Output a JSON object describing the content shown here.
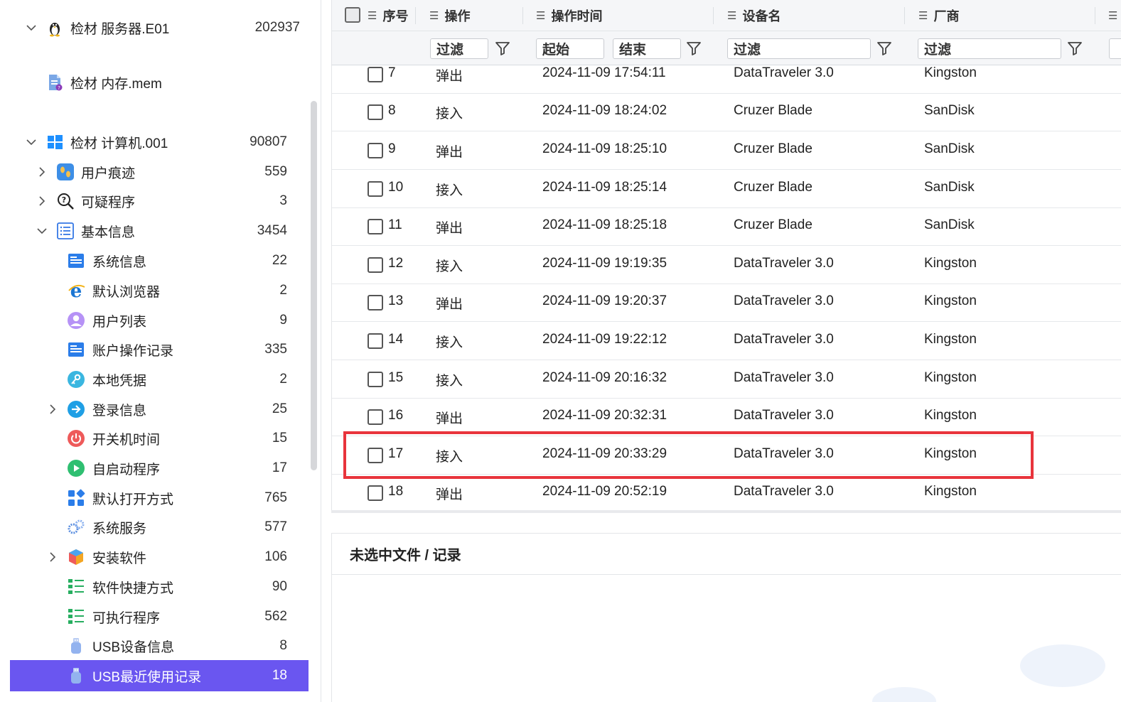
{
  "tree": {
    "items": [
      {
        "label": "检材  服务器.E01",
        "count": "202937",
        "icon": "linux-penguin-icon",
        "expander": "expanded"
      },
      {
        "label": "检材  内存.mem",
        "count": "",
        "icon": "memory-file-icon",
        "expander": ""
      },
      {
        "label": "检材  计算机.001",
        "count": "90807",
        "icon": "windows-logo-icon",
        "expander": "expanded"
      },
      {
        "label": "用户痕迹",
        "count": "559",
        "icon": "footprints-icon",
        "expander": "collapsed"
      },
      {
        "label": "可疑程序",
        "count": "3",
        "icon": "magnifier-question-icon",
        "expander": "collapsed"
      },
      {
        "label": "基本信息",
        "count": "3454",
        "icon": "list-document-icon",
        "expander": "expanded"
      },
      {
        "label": "系统信息",
        "count": "22",
        "icon": "system-info-icon",
        "expander": ""
      },
      {
        "label": "默认浏览器",
        "count": "2",
        "icon": "ie-browser-icon",
        "expander": ""
      },
      {
        "label": "用户列表",
        "count": "9",
        "icon": "user-avatar-icon",
        "expander": ""
      },
      {
        "label": "账户操作记录",
        "count": "335",
        "icon": "account-log-icon",
        "expander": ""
      },
      {
        "label": "本地凭据",
        "count": "2",
        "icon": "key-icon",
        "expander": ""
      },
      {
        "label": "登录信息",
        "count": "25",
        "icon": "login-arrow-icon",
        "expander": "collapsed"
      },
      {
        "label": "开关机时间",
        "count": "15",
        "icon": "power-icon",
        "expander": ""
      },
      {
        "label": "自启动程序",
        "count": "17",
        "icon": "play-icon",
        "expander": ""
      },
      {
        "label": "默认打开方式",
        "count": "765",
        "icon": "apps-grid-icon",
        "expander": ""
      },
      {
        "label": "系统服务",
        "count": "577",
        "icon": "gears-icon",
        "expander": ""
      },
      {
        "label": "安装软件",
        "count": "106",
        "icon": "package-box-icon",
        "expander": "collapsed"
      },
      {
        "label": "软件快捷方式",
        "count": "90",
        "icon": "shortcut-list-icon",
        "expander": ""
      },
      {
        "label": "可执行程序",
        "count": "562",
        "icon": "executable-list-icon",
        "expander": ""
      },
      {
        "label": "USB设备信息",
        "count": "8",
        "icon": "usb-drive-icon",
        "expander": ""
      },
      {
        "label": "USB最近使用记录",
        "count": "18",
        "icon": "usb-drive-icon",
        "expander": "",
        "selected": true
      }
    ]
  },
  "table": {
    "columns": [
      {
        "label": "序号",
        "icon": "column-menu-icon"
      },
      {
        "label": "操作",
        "icon": "column-menu-icon"
      },
      {
        "label": "操作时间",
        "icon": "column-menu-icon"
      },
      {
        "label": "设备名",
        "icon": "column-menu-icon"
      },
      {
        "label": "厂商",
        "icon": "column-menu-icon"
      }
    ],
    "filters": {
      "op": "过滤",
      "time_start": "起始",
      "time_end": "结束",
      "device": "过滤",
      "vendor": "过滤"
    },
    "rows": [
      {
        "no": "7",
        "op": "弹出",
        "time": "2024-11-09 17:54:11",
        "device": "DataTraveler 3.0",
        "vendor": "Kingston"
      },
      {
        "no": "8",
        "op": "接入",
        "time": "2024-11-09 18:24:02",
        "device": "Cruzer Blade",
        "vendor": "SanDisk"
      },
      {
        "no": "9",
        "op": "弹出",
        "time": "2024-11-09 18:25:10",
        "device": "Cruzer Blade",
        "vendor": "SanDisk"
      },
      {
        "no": "10",
        "op": "接入",
        "time": "2024-11-09 18:25:14",
        "device": "Cruzer Blade",
        "vendor": "SanDisk"
      },
      {
        "no": "11",
        "op": "弹出",
        "time": "2024-11-09 18:25:18",
        "device": "Cruzer Blade",
        "vendor": "SanDisk"
      },
      {
        "no": "12",
        "op": "接入",
        "time": "2024-11-09 19:19:35",
        "device": "DataTraveler 3.0",
        "vendor": "Kingston"
      },
      {
        "no": "13",
        "op": "弹出",
        "time": "2024-11-09 19:20:37",
        "device": "DataTraveler 3.0",
        "vendor": "Kingston"
      },
      {
        "no": "14",
        "op": "接入",
        "time": "2024-11-09 19:22:12",
        "device": "DataTraveler 3.0",
        "vendor": "Kingston"
      },
      {
        "no": "15",
        "op": "接入",
        "time": "2024-11-09 20:16:32",
        "device": "DataTraveler 3.0",
        "vendor": "Kingston"
      },
      {
        "no": "16",
        "op": "弹出",
        "time": "2024-11-09 20:32:31",
        "device": "DataTraveler 3.0",
        "vendor": "Kingston"
      },
      {
        "no": "17",
        "op": "接入",
        "time": "2024-11-09 20:33:29",
        "device": "DataTraveler 3.0",
        "vendor": "Kingston",
        "highlighted": true
      },
      {
        "no": "18",
        "op": "弹出",
        "time": "2024-11-09 20:52:19",
        "device": "DataTraveler 3.0",
        "vendor": "Kingston"
      }
    ]
  },
  "detail": {
    "title": "未选中文件 / 记录"
  },
  "colors": {
    "selected_bg": "#6a56f0",
    "highlight_border": "#e8343c"
  }
}
